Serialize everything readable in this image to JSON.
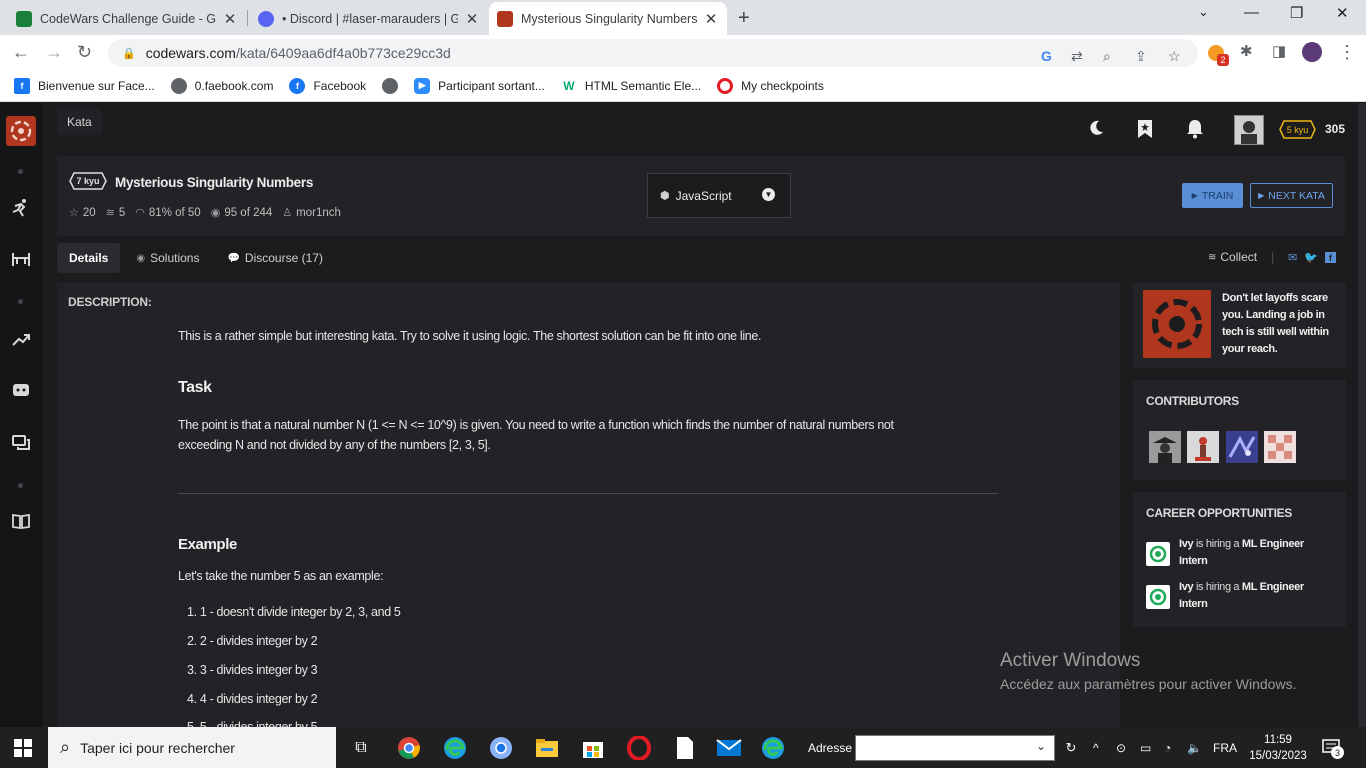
{
  "browser": {
    "tabs": [
      {
        "title": "CodeWars Challenge Guide - Go"
      },
      {
        "title": "• Discord | #laser-marauders | GM"
      },
      {
        "title": "Mysterious Singularity Numbers |"
      }
    ],
    "url_host": "codewars.com",
    "url_path": "/kata/6409aa6df4a0b773ce29cc3d",
    "extension_badge": "2",
    "bookmarks": [
      {
        "label": "Bienvenue sur Face..."
      },
      {
        "label": "0.faebook.com"
      },
      {
        "label": "Facebook"
      },
      {
        "label": ""
      },
      {
        "label": "Participant sortant..."
      },
      {
        "label": "HTML Semantic Ele..."
      },
      {
        "label": "My checkpoints"
      }
    ]
  },
  "codewars": {
    "section_pill": "Kata",
    "user_rank": "5 kyu",
    "honor": "305",
    "kata": {
      "rank": "7 kyu",
      "title": "Mysterious Singularity Numbers",
      "stars": "20",
      "collections": "5",
      "satisfaction": "81% of 50",
      "completed": "95 of 244",
      "author": "mor1nch",
      "language": "JavaScript",
      "train_label": "TRAIN",
      "next_label": "NEXT KATA"
    },
    "tabs": [
      {
        "label": "Details"
      },
      {
        "label": "Solutions"
      },
      {
        "label": "Discourse (17)"
      }
    ],
    "collect_label": "Collect",
    "description": {
      "label": "DESCRIPTION:",
      "intro": "This is a rather simple but interesting kata. Try to solve it using logic. The shortest solution can be fit into one line.",
      "task_heading": "Task",
      "task_line1": "The point is that a natural number N (1 <= N <= 10^9) is given. You need to write a function which finds the number of natural numbers not",
      "task_line2": "exceeding N and not divided by any of the numbers [2, 3, 5].",
      "example_heading": "Example",
      "example_intro": "Let's take the number 5 as an example:",
      "example_items": [
        "1.  1 - doesn't divide integer by 2, 3, and 5",
        "2.  2 - divides integer by 2",
        "3.  3 - divides integer by 3",
        "4.  4 - divides integer by 2",
        "5.  5 - divides integer by 5"
      ]
    },
    "ad_text": "Don't let layoffs scare you. Landing a job in tech is still well within your reach.",
    "contributors_title": "CONTRIBUTORS",
    "career_title": "CAREER OPPORTUNITIES",
    "jobs": [
      {
        "company": "Ivy",
        "middle": " is hiring a ",
        "role": "ML Engineer Intern"
      },
      {
        "company": "Ivy",
        "middle": " is hiring a ",
        "role": "ML Engineer Intern"
      }
    ],
    "watermark_title": "Activer Windows",
    "watermark_sub": "Accédez aux paramètres pour activer Windows."
  },
  "taskbar": {
    "search_placeholder": "Taper ici pour rechercher",
    "address_label": "Adresse",
    "language": "FRA",
    "time": "11:59",
    "date": "15/03/2023",
    "notification_count": "3"
  },
  "colors": {
    "codewars_red": "#b1361e",
    "accent_blue": "#5a8fd6",
    "rank_yellow": "#ecb613",
    "background": "#1c1c1f",
    "panel": "#232327"
  }
}
